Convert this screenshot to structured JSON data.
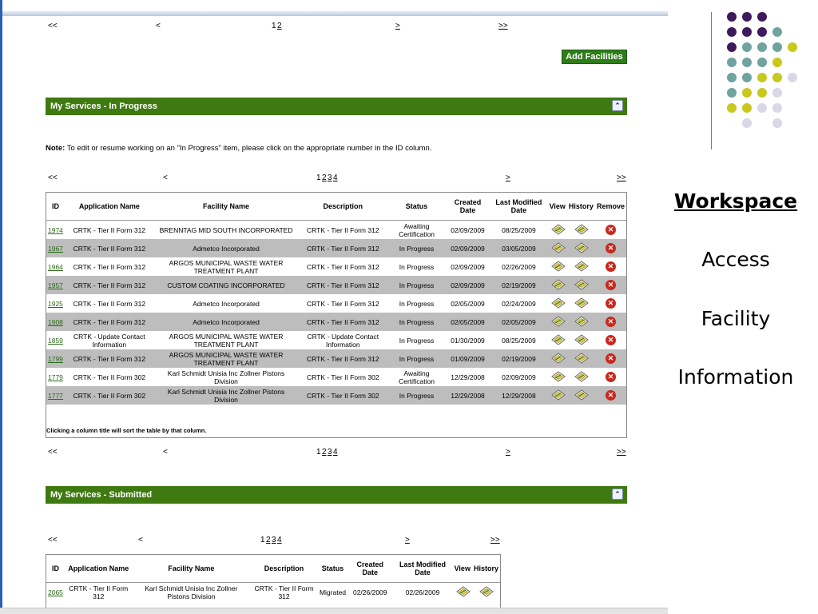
{
  "top_pager": {
    "first": "<<",
    "prev": "<",
    "pages": [
      "1",
      "2"
    ],
    "current": "1",
    "next": ">",
    "last": ">>"
  },
  "add_button": "Add Facilities",
  "in_progress": {
    "title": "My Services - In Progress",
    "note_label": "Note:",
    "note_text": " To edit or resume working on an \"In Progress\" item, please click on the appropriate number in the ID column.",
    "pager": {
      "first": "<<",
      "prev": "<",
      "pages": [
        "1",
        "2",
        "3",
        "4"
      ],
      "current": "1",
      "next": ">",
      "last": ">>"
    },
    "columns": [
      "ID",
      "Application Name",
      "Facility Name",
      "Description",
      "Status",
      "Created Date",
      "Last Modified Date",
      "View",
      "History",
      "Remove"
    ],
    "rows": [
      {
        "id": "1974",
        "app": "CRTK - Tier II Form 312",
        "facility": "BRENNTAG MID SOUTH INCORPORATED",
        "desc": "CRTK - Tier II Form 312",
        "status": "Awaiting Certification",
        "created": "02/09/2009",
        "modified": "08/25/2009"
      },
      {
        "id": "1967",
        "app": "CRTK - Tier II Form 312",
        "facility": "Admetco Incorporated",
        "desc": "CRTK - Tier II Form 312",
        "status": "In Progress",
        "created": "02/09/2009",
        "modified": "03/05/2009"
      },
      {
        "id": "1964",
        "app": "CRTK - Tier II Form 312",
        "facility": "ARGOS MUNICIPAL WASTE WATER TREATMENT PLANT",
        "desc": "CRTK - Tier II Form 312",
        "status": "In Progress",
        "created": "02/09/2009",
        "modified": "02/26/2009"
      },
      {
        "id": "1957",
        "app": "CRTK - Tier II Form 312",
        "facility": "CUSTOM COATING INCORPORATED",
        "desc": "CRTK - Tier II Form 312",
        "status": "In Progress",
        "created": "02/09/2009",
        "modified": "02/19/2009"
      },
      {
        "id": "1925",
        "app": "CRTK - Tier II Form 312",
        "facility": "Admetco Incorporated",
        "desc": "CRTK - Tier II Form 312",
        "status": "In Progress",
        "created": "02/05/2009",
        "modified": "02/24/2009"
      },
      {
        "id": "1908",
        "app": "CRTK - Tier II Form 312",
        "facility": "Admetco Incorporated",
        "desc": "CRTK - Tier II Form 312",
        "status": "In Progress",
        "created": "02/05/2009",
        "modified": "02/05/2009"
      },
      {
        "id": "1859",
        "app": "CRTK - Update Contact Information",
        "facility": "ARGOS MUNICIPAL WASTE WATER TREATMENT PLANT",
        "desc": "CRTK - Update Contact Information",
        "status": "In Progress",
        "created": "01/30/2009",
        "modified": "08/25/2009"
      },
      {
        "id": "1799",
        "app": "CRTK - Tier II Form 312",
        "facility": "ARGOS MUNICIPAL WASTE WATER TREATMENT PLANT",
        "desc": "CRTK - Tier II Form 312",
        "status": "In Progress",
        "created": "01/09/2009",
        "modified": "02/19/2009"
      },
      {
        "id": "1779",
        "app": "CRTK - Tier II Form 302",
        "facility": "Karl Schmidt Unisia Inc Zollner Pistons Division",
        "desc": "CRTK - Tier II Form 302",
        "status": "Awaiting Certification",
        "created": "12/29/2008",
        "modified": "02/09/2009"
      },
      {
        "id": "1777",
        "app": "CRTK - Tier II Form 302",
        "facility": "Karl Schmidt Unisia Inc Zollner Pistons Division",
        "desc": "CRTK - Tier II Form 302",
        "status": "In Progress",
        "created": "12/29/2008",
        "modified": "12/29/2008"
      }
    ],
    "footer": "Clicking a column title will sort the table by that column."
  },
  "submitted": {
    "title": "My Services - Submitted",
    "pager": {
      "first": "<<",
      "prev": "<",
      "pages": [
        "1",
        "2",
        "3",
        "4"
      ],
      "current": "1",
      "next": ">",
      "last": ">>"
    },
    "columns": [
      "ID",
      "Application Name",
      "Facility Name",
      "Description",
      "Status",
      "Created Date",
      "Last Modified Date",
      "View",
      "History"
    ],
    "rows": [
      {
        "id": "2065",
        "app": "CRTK - Tier II Form 312",
        "facility": "Karl Schmidt Unisia Inc Zollner Pistons Division",
        "desc": "CRTK - Tier II Form 312",
        "status": "Migrated",
        "created": "02/26/2009",
        "modified": "02/26/2009"
      }
    ]
  },
  "side_menu": {
    "items": [
      "Workspace",
      "Access",
      "Facility",
      "Information"
    ],
    "active": "Workspace"
  },
  "colors": {
    "section_green": "#3f7a10",
    "button_green": "#2e7d1a",
    "row_gray": "#bdbdbd",
    "dot_purple": "#3d1a5b",
    "dot_teal": "#6fa3a0",
    "dot_yellow": "#c8c81e",
    "dot_lilac": "#d8d8e6"
  },
  "icons": {
    "view": "view-icon",
    "history": "history-icon",
    "remove": "remove-icon",
    "collapse": "collapse-icon"
  }
}
